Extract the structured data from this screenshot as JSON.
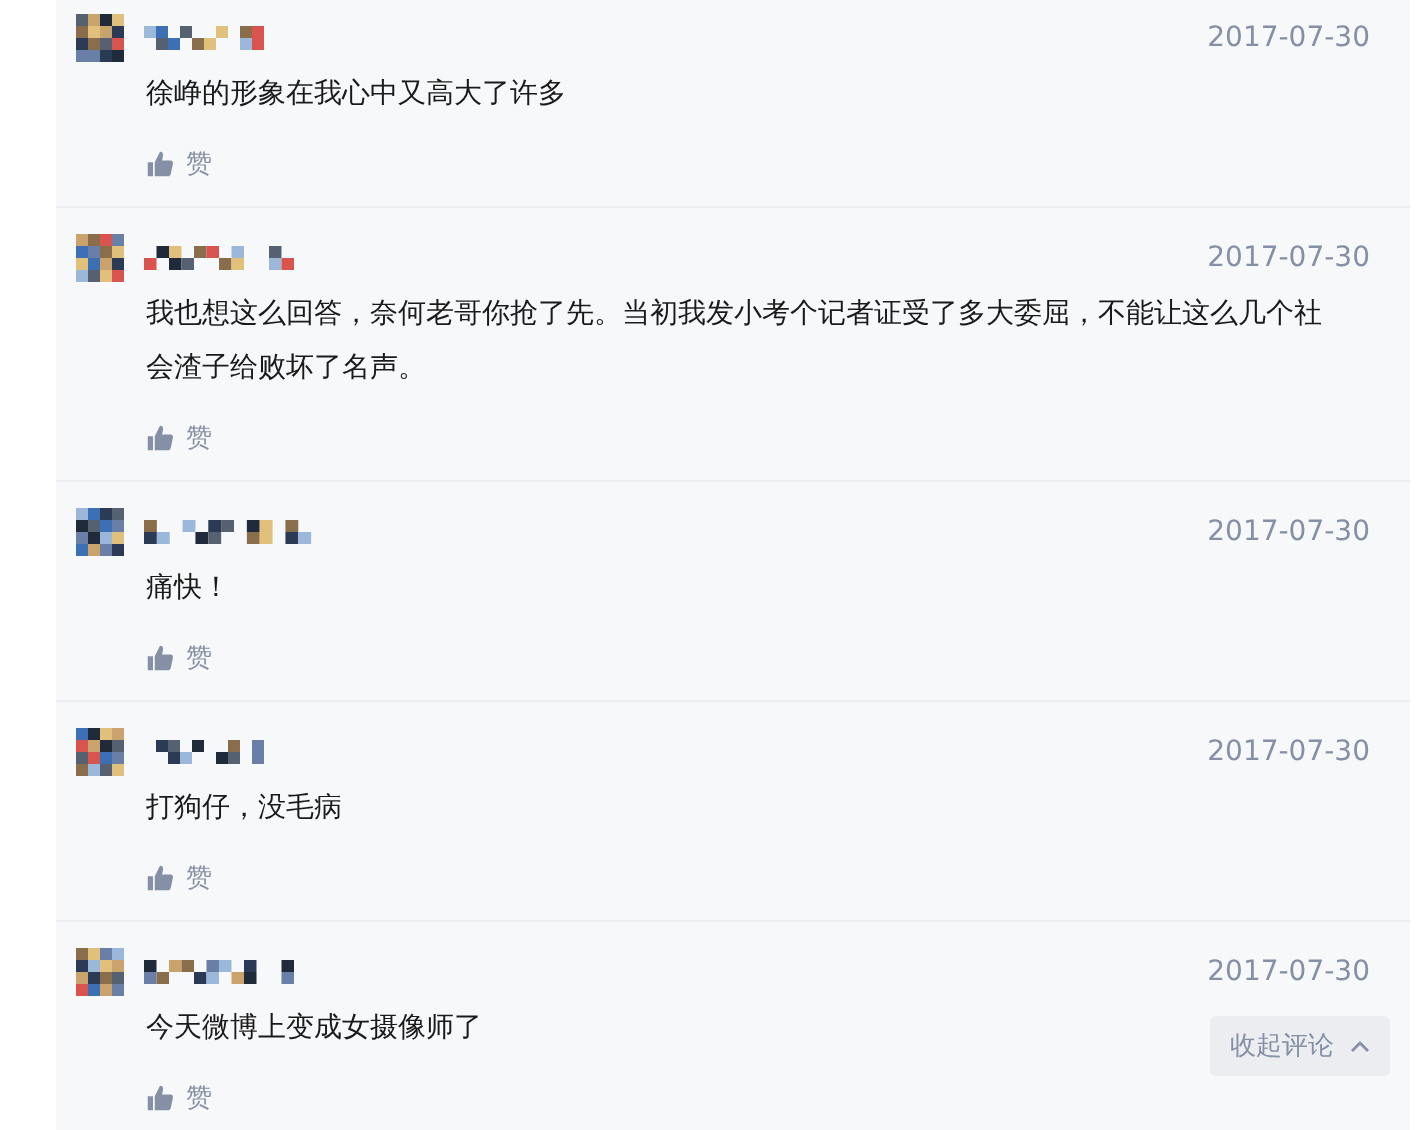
{
  "comments": [
    {
      "text": "徐峥的形象在我心中又高大了许多",
      "date": "2017-07-30",
      "like_label": "赞"
    },
    {
      "text": "我也想这么回答，奈何老哥你抢了先。当初我发小考个记者证受了多大委屈，不能让这么几个社会渣子给败坏了名声。",
      "date": "2017-07-30",
      "like_label": "赞"
    },
    {
      "text": "痛快！",
      "date": "2017-07-30",
      "like_label": "赞"
    },
    {
      "text": "打狗仔，没毛病",
      "date": "2017-07-30",
      "like_label": "赞"
    },
    {
      "text": "今天微博上变成女摄像师了",
      "date": "2017-07-30",
      "like_label": "赞"
    }
  ],
  "collapse_button": {
    "label": "收起评论"
  }
}
